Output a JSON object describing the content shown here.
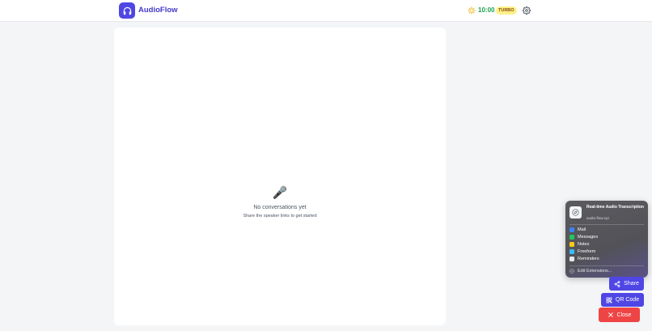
{
  "app": {
    "name": "AudioFlow"
  },
  "header": {
    "timer": "10:00",
    "mode_badge": "TURBO"
  },
  "empty_state": {
    "icon": "microphone",
    "title": "No conversations yet",
    "subtitle": "Share the speaker links to get started"
  },
  "share_sheet": {
    "title": "Real-time Audio Transcription",
    "url": "audio-flow.xyz",
    "items": [
      {
        "label": "Mail",
        "icon": "mail-icon",
        "color": "#3b82f6"
      },
      {
        "label": "Messages",
        "icon": "messages-icon",
        "color": "#22c55e"
      },
      {
        "label": "Notes",
        "icon": "notes-icon",
        "color": "#facc15"
      },
      {
        "label": "Freeform",
        "icon": "freeform-icon",
        "color": "#38bdf8"
      },
      {
        "label": "Reminders",
        "icon": "reminders-icon",
        "color": "#e5e7eb"
      }
    ],
    "edit_label": "Edit Extensions..."
  },
  "actions": {
    "share": "Share",
    "qr_code": "QR Code",
    "close": "Close"
  },
  "colors": {
    "primary": "#4f46e5",
    "danger": "#ef4444",
    "timer": "#16a34a"
  }
}
